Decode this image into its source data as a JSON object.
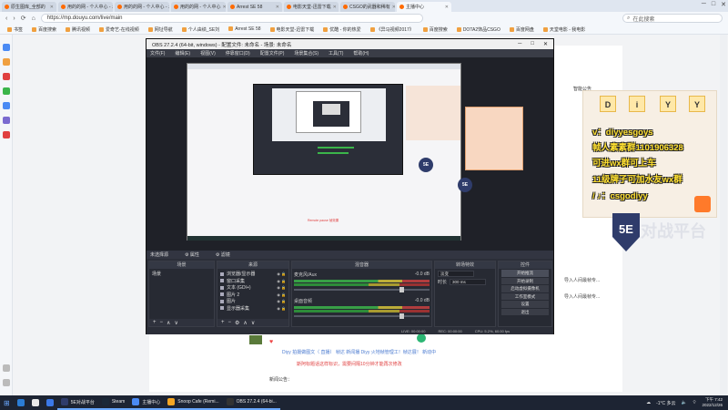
{
  "browser": {
    "tabs": [
      {
        "label": "原生图库_全部的",
        "active": false
      },
      {
        "label": "用的的网 - 个人中心 - 斗鱼",
        "active": false
      },
      {
        "label": "用的的网 - 个人中心 - 斗鱼",
        "active": false
      },
      {
        "label": "用的的网 - 个人中心",
        "active": false
      },
      {
        "label": "Arrest SE 58",
        "active": false
      },
      {
        "label": "电影天堂-迅雷下载",
        "active": false
      },
      {
        "label": "CSGO的武器和稀有",
        "active": false
      },
      {
        "label": "主播中心",
        "active": true
      }
    ],
    "window_controls": [
      "─",
      "□",
      "✕"
    ],
    "nav": [
      "‹",
      "›",
      "⟳",
      "⌂"
    ],
    "url": "https://mp.douyu.com/live/main",
    "search_placeholder": "在此搜索",
    "bookmarks": [
      "书签",
      "百度搜索",
      "腾讯视频",
      "爱奇艺-在线视频",
      "网址导航",
      "个人由绩_SE刘",
      "Arrest SE 58",
      "电影天堂-迅雷下载",
      "优酷 - 你的热爱",
      "《异马视频2017》",
      "百度搜索",
      "DOTA2饰品CSGO",
      "百度网盘",
      "天堂电影 - 我电影"
    ]
  },
  "page": {
    "smart_label": "智能公告",
    "right_item_1": "导入人间最帧专...",
    "right_item_2": "导入人间最帧专...",
    "red_note": "斯阿标题话这样标识，需要间隔10分钟才能再次修改",
    "blue_row": "Diyy    拍摄做图文（ 直播）  帧达    新闻播    Diyy 火地帧管理工！帧达展！ 新动中",
    "label": "新闻公告："
  },
  "obs": {
    "title": "OBS 27.2.4 (64-bit, windows) - 配置文件: 未命名 - 场景: 未命名",
    "title_controls": [
      "─",
      "□",
      "✕"
    ],
    "menu": [
      "文件(F)",
      "编辑(E)",
      "视图(V)",
      "停靠窗口(D)",
      "配置文件(P)",
      "场景集合(S)",
      "工具(T)",
      "帮助(H)"
    ],
    "dock_header": [
      "未选择源",
      "属性",
      "滤镜"
    ],
    "capture_note": "Remote pause 帧效果",
    "capture_logo": "5E",
    "scenes": {
      "title": "场景",
      "items": [
        "场景"
      ]
    },
    "sources": {
      "title": "来源",
      "items": [
        "浏览器/显示器",
        "窗口采集",
        "文本 (GDI+)",
        "图片 2",
        "图片",
        "显示器采集"
      ]
    },
    "mixer": {
      "title": "混音器",
      "tracks": [
        {
          "name": "麦克风/Aux",
          "db": "-0.0 dB"
        },
        {
          "name": "桌面音频",
          "db": "-0.0 dB"
        }
      ]
    },
    "transitions": {
      "title": "转场特效",
      "type": "淡变",
      "duration_label": "时长",
      "duration": "300 ms"
    },
    "controls": {
      "title": "控件",
      "buttons": [
        "开始推流",
        "开始录制",
        "启动虚拟摄像机",
        "工作室模式",
        "设置",
        "退出"
      ]
    },
    "status": [
      "LIVE: 00:00:00",
      "REC: 00:00:00",
      "CPU: 5.2%, 60.00 fps"
    ],
    "foot_buttons": [
      "+",
      "−",
      "∧",
      "∨"
    ],
    "source_foot": [
      "+",
      "−",
      "⚙",
      "∧",
      "∨"
    ]
  },
  "overlay": {
    "letters": [
      "D",
      "i",
      "Y",
      "Y"
    ],
    "lines": [
      "v：diyyesgoys",
      "帧人素素群1101906328",
      "可进wx群可上车",
      "11级牌子可加水友wx群",
      "/ ♪：csgodiyy"
    ],
    "logo": "5E",
    "logo_text": "对战平台"
  },
  "taskbar": {
    "items": [
      {
        "label": "",
        "color": "#2b7cd3",
        "running": false
      },
      {
        "label": "",
        "color": "#e9e9e9",
        "running": false
      },
      {
        "label": "",
        "color": "#3b78e7",
        "running": false
      },
      {
        "label": "5E对战平台",
        "color": "#2f3c6b",
        "running": true
      },
      {
        "label": "Steam",
        "color": "#1b2838",
        "running": true
      },
      {
        "label": "主播中心",
        "color": "#4a8af4",
        "running": true
      },
      {
        "label": "Snoop Cafe (Remi...",
        "color": "#f5a623",
        "running": true
      },
      {
        "label": "OBS 27.2.4 (64-bi...",
        "color": "#333",
        "running": true
      }
    ],
    "weather": "-1°C 多云",
    "time": "下午 7:42",
    "date": "2022/12/26"
  },
  "colors": {
    "obs_bg": "#2b2e38",
    "accent_green": "#3bb54a",
    "banner_yellow": "#ffe030",
    "taskbar": "#1d2433"
  }
}
